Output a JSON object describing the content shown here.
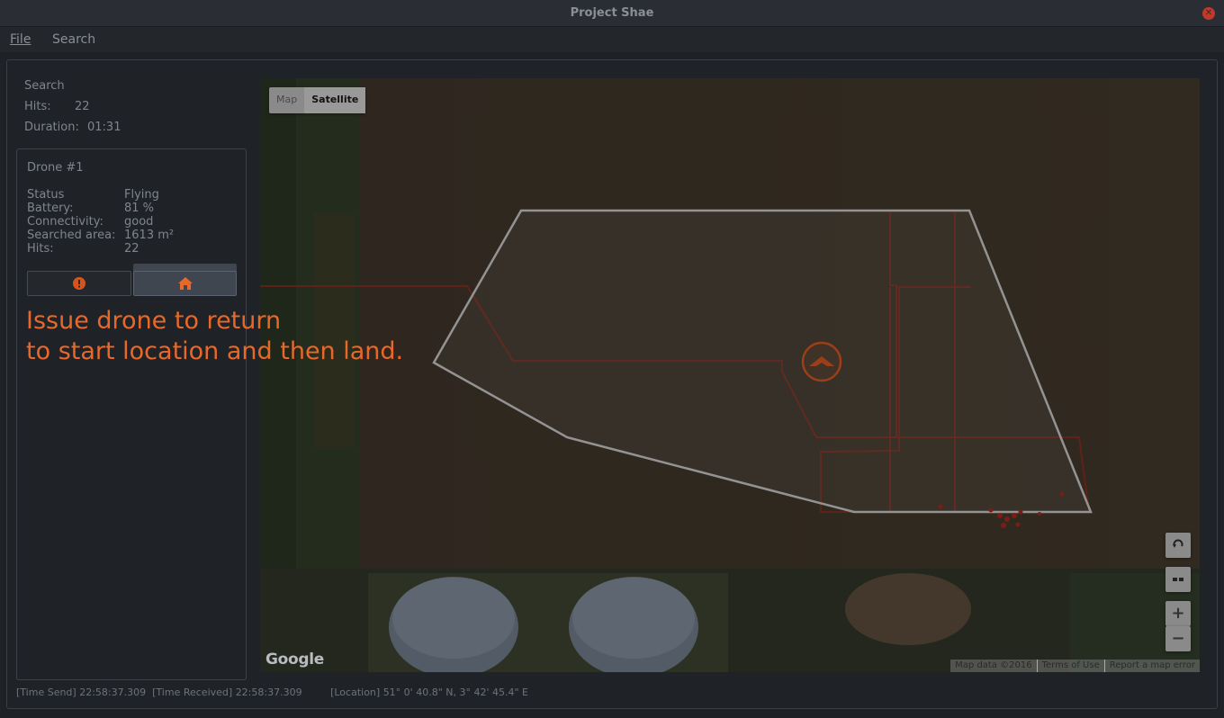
{
  "window": {
    "title": "Project Shae"
  },
  "menu": {
    "file": "File",
    "search": "Search"
  },
  "summary": {
    "heading": "Search",
    "hits_label": "Hits:",
    "hits_value": "22",
    "duration_label": "Duration:",
    "duration_value": "01:31"
  },
  "drone": {
    "name": "Drone #1",
    "stats": [
      {
        "label": "Status",
        "value": "Flying"
      },
      {
        "label": "Battery:",
        "value": "81 %"
      },
      {
        "label": "Connectivity:",
        "value": "good"
      },
      {
        "label": "Searched area:",
        "value": "1613 m²"
      },
      {
        "label": "Hits:",
        "value": "22"
      }
    ],
    "buttons": {
      "warn_icon": "exclamation-icon",
      "home_icon": "home-icon"
    }
  },
  "annotation": {
    "line1": "Issue drone to return",
    "line2": "to start location and then land."
  },
  "map": {
    "type_map": "Map",
    "type_satellite": "Satellite",
    "selected_type": "Satellite",
    "logo": "Google",
    "attribution": [
      "Map data ©2016",
      "Terms of Use",
      "Report a map error"
    ],
    "controls": {
      "rotate_icon": "rotate-icon",
      "tilt_icon": "tilt-icon",
      "zoom_in": "+",
      "zoom_out": "−"
    },
    "colors": {
      "boundary": "#c8c8c8",
      "path": "#8b2a1c",
      "drone": "#d4541e"
    }
  },
  "status": {
    "time_send_label": "[Time Send]",
    "time_send_value": "22:58:37.309",
    "time_received_label": "[Time Received]",
    "time_received_value": "22:58:37.309",
    "location_label": "[Location]",
    "location_value": "51° 0' 40.8\" N, 3° 42' 45.4\" E"
  },
  "colors": {
    "accent": "#e8682a",
    "warning": "#d4541e"
  }
}
